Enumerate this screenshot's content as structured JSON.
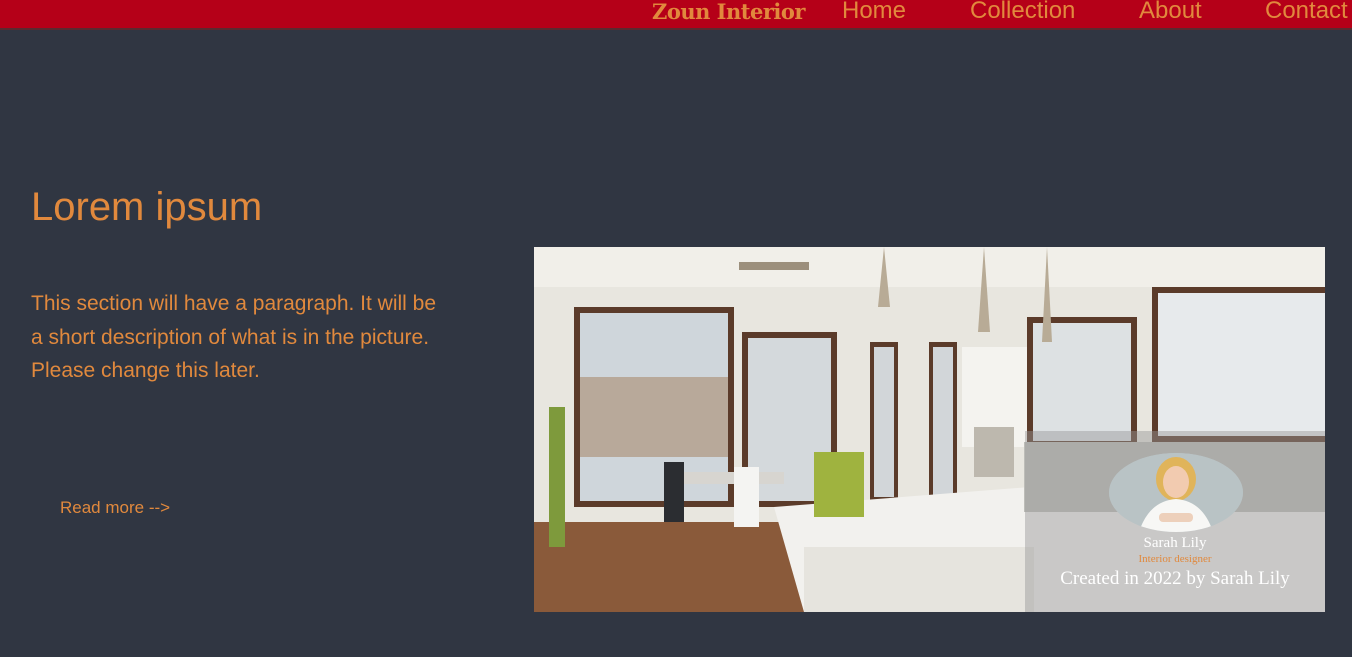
{
  "nav": {
    "brand": "Zoun Interior",
    "links": [
      "Home",
      "Collection",
      "About",
      "Contact"
    ]
  },
  "hero": {
    "title": "Lorem ipsum",
    "paragraph": "This section will have a paragraph. It will be a short description of what is in the picture. Please change this later.",
    "read_more": "Read more -->"
  },
  "photo": {
    "designer_name": "Sarah Lily",
    "designer_role": "Interior designer",
    "caption": "Created in 2022 by Sarah Lily"
  },
  "colors": {
    "background": "#303642",
    "navbar": "#b50018",
    "accent": "#e1893d",
    "caption_text": "#ffffff"
  }
}
